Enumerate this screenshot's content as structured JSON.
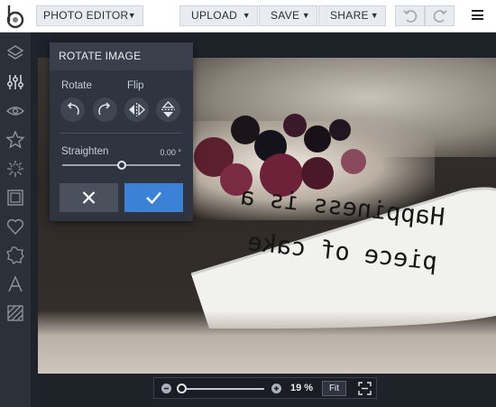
{
  "toolbar": {
    "editor_menu": "PHOTO EDITOR",
    "upload": "UPLOAD",
    "save": "SAVE",
    "share": "SHARE",
    "caret": "▼"
  },
  "sidebar": {
    "icons": [
      "layers-icon",
      "adjust-sliders-icon",
      "eye-icon",
      "star-icon",
      "effects-icon",
      "frame-icon",
      "heart-icon",
      "sticker-icon",
      "text-icon",
      "texture-icon"
    ]
  },
  "rotate_panel": {
    "title": "ROTATE IMAGE",
    "rotate_label": "Rotate",
    "flip_label": "Flip",
    "straighten_label": "Straighten",
    "straighten_value": "0.00 °",
    "straighten_level": 0.5
  },
  "photo": {
    "knife_line1": "Happiness is a",
    "knife_line2": "piece of cake"
  },
  "zoom": {
    "percent": "19 %",
    "fit_label": "Fit",
    "level": 0.19
  },
  "colors": {
    "accent": "#3b82d6",
    "panel_bg": "#2f3540",
    "sidebar_bg": "#2b3039"
  }
}
